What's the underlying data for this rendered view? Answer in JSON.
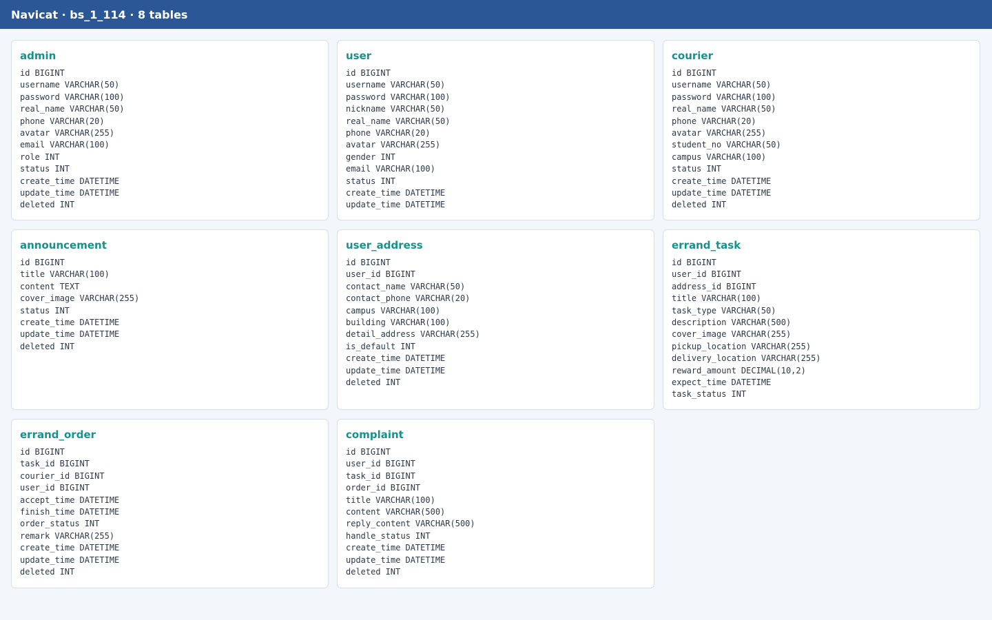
{
  "window": {
    "title": "Navicat · bs_1_114 · 8 tables"
  },
  "tables": [
    {
      "name": "admin",
      "fields": [
        {
          "name": "id",
          "type": "BIGINT"
        },
        {
          "name": "username",
          "type": "VARCHAR(50)"
        },
        {
          "name": "password",
          "type": "VARCHAR(100)"
        },
        {
          "name": "real_name",
          "type": "VARCHAR(50)"
        },
        {
          "name": "phone",
          "type": "VARCHAR(20)"
        },
        {
          "name": "avatar",
          "type": "VARCHAR(255)"
        },
        {
          "name": "email",
          "type": "VARCHAR(100)"
        },
        {
          "name": "role",
          "type": "INT"
        },
        {
          "name": "status",
          "type": "INT"
        },
        {
          "name": "create_time",
          "type": "DATETIME"
        },
        {
          "name": "update_time",
          "type": "DATETIME"
        },
        {
          "name": "deleted",
          "type": "INT"
        }
      ]
    },
    {
      "name": "user",
      "fields": [
        {
          "name": "id",
          "type": "BIGINT"
        },
        {
          "name": "username",
          "type": "VARCHAR(50)"
        },
        {
          "name": "password",
          "type": "VARCHAR(100)"
        },
        {
          "name": "nickname",
          "type": "VARCHAR(50)"
        },
        {
          "name": "real_name",
          "type": "VARCHAR(50)"
        },
        {
          "name": "phone",
          "type": "VARCHAR(20)"
        },
        {
          "name": "avatar",
          "type": "VARCHAR(255)"
        },
        {
          "name": "gender",
          "type": "INT"
        },
        {
          "name": "email",
          "type": "VARCHAR(100)"
        },
        {
          "name": "status",
          "type": "INT"
        },
        {
          "name": "create_time",
          "type": "DATETIME"
        },
        {
          "name": "update_time",
          "type": "DATETIME"
        }
      ]
    },
    {
      "name": "courier",
      "fields": [
        {
          "name": "id",
          "type": "BIGINT"
        },
        {
          "name": "username",
          "type": "VARCHAR(50)"
        },
        {
          "name": "password",
          "type": "VARCHAR(100)"
        },
        {
          "name": "real_name",
          "type": "VARCHAR(50)"
        },
        {
          "name": "phone",
          "type": "VARCHAR(20)"
        },
        {
          "name": "avatar",
          "type": "VARCHAR(255)"
        },
        {
          "name": "student_no",
          "type": "VARCHAR(50)"
        },
        {
          "name": "campus",
          "type": "VARCHAR(100)"
        },
        {
          "name": "status",
          "type": "INT"
        },
        {
          "name": "create_time",
          "type": "DATETIME"
        },
        {
          "name": "update_time",
          "type": "DATETIME"
        },
        {
          "name": "deleted",
          "type": "INT"
        }
      ]
    },
    {
      "name": "announcement",
      "fields": [
        {
          "name": "id",
          "type": "BIGINT"
        },
        {
          "name": "title",
          "type": "VARCHAR(100)"
        },
        {
          "name": "content",
          "type": "TEXT"
        },
        {
          "name": "cover_image",
          "type": "VARCHAR(255)"
        },
        {
          "name": "status",
          "type": "INT"
        },
        {
          "name": "create_time",
          "type": "DATETIME"
        },
        {
          "name": "update_time",
          "type": "DATETIME"
        },
        {
          "name": "deleted",
          "type": "INT"
        }
      ]
    },
    {
      "name": "user_address",
      "fields": [
        {
          "name": "id",
          "type": "BIGINT"
        },
        {
          "name": "user_id",
          "type": "BIGINT"
        },
        {
          "name": "contact_name",
          "type": "VARCHAR(50)"
        },
        {
          "name": "contact_phone",
          "type": "VARCHAR(20)"
        },
        {
          "name": "campus",
          "type": "VARCHAR(100)"
        },
        {
          "name": "building",
          "type": "VARCHAR(100)"
        },
        {
          "name": "detail_address",
          "type": "VARCHAR(255)"
        },
        {
          "name": "is_default",
          "type": "INT"
        },
        {
          "name": "create_time",
          "type": "DATETIME"
        },
        {
          "name": "update_time",
          "type": "DATETIME"
        },
        {
          "name": "deleted",
          "type": "INT"
        }
      ]
    },
    {
      "name": "errand_task",
      "fields": [
        {
          "name": "id",
          "type": "BIGINT"
        },
        {
          "name": "user_id",
          "type": "BIGINT"
        },
        {
          "name": "address_id",
          "type": "BIGINT"
        },
        {
          "name": "title",
          "type": "VARCHAR(100)"
        },
        {
          "name": "task_type",
          "type": "VARCHAR(50)"
        },
        {
          "name": "description",
          "type": "VARCHAR(500)"
        },
        {
          "name": "cover_image",
          "type": "VARCHAR(255)"
        },
        {
          "name": "pickup_location",
          "type": "VARCHAR(255)"
        },
        {
          "name": "delivery_location",
          "type": "VARCHAR(255)"
        },
        {
          "name": "reward_amount",
          "type": "DECIMAL(10,2)"
        },
        {
          "name": "expect_time",
          "type": "DATETIME"
        },
        {
          "name": "task_status",
          "type": "INT"
        }
      ]
    },
    {
      "name": "errand_order",
      "fields": [
        {
          "name": "id",
          "type": "BIGINT"
        },
        {
          "name": "task_id",
          "type": "BIGINT"
        },
        {
          "name": "courier_id",
          "type": "BIGINT"
        },
        {
          "name": "user_id",
          "type": "BIGINT"
        },
        {
          "name": "accept_time",
          "type": "DATETIME"
        },
        {
          "name": "finish_time",
          "type": "DATETIME"
        },
        {
          "name": "order_status",
          "type": "INT"
        },
        {
          "name": "remark",
          "type": "VARCHAR(255)"
        },
        {
          "name": "create_time",
          "type": "DATETIME"
        },
        {
          "name": "update_time",
          "type": "DATETIME"
        },
        {
          "name": "deleted",
          "type": "INT"
        }
      ]
    },
    {
      "name": "complaint",
      "fields": [
        {
          "name": "id",
          "type": "BIGINT"
        },
        {
          "name": "user_id",
          "type": "BIGINT"
        },
        {
          "name": "task_id",
          "type": "BIGINT"
        },
        {
          "name": "order_id",
          "type": "BIGINT"
        },
        {
          "name": "title",
          "type": "VARCHAR(100)"
        },
        {
          "name": "content",
          "type": "VARCHAR(500)"
        },
        {
          "name": "reply_content",
          "type": "VARCHAR(500)"
        },
        {
          "name": "handle_status",
          "type": "INT"
        },
        {
          "name": "create_time",
          "type": "DATETIME"
        },
        {
          "name": "update_time",
          "type": "DATETIME"
        },
        {
          "name": "deleted",
          "type": "INT"
        }
      ]
    }
  ]
}
